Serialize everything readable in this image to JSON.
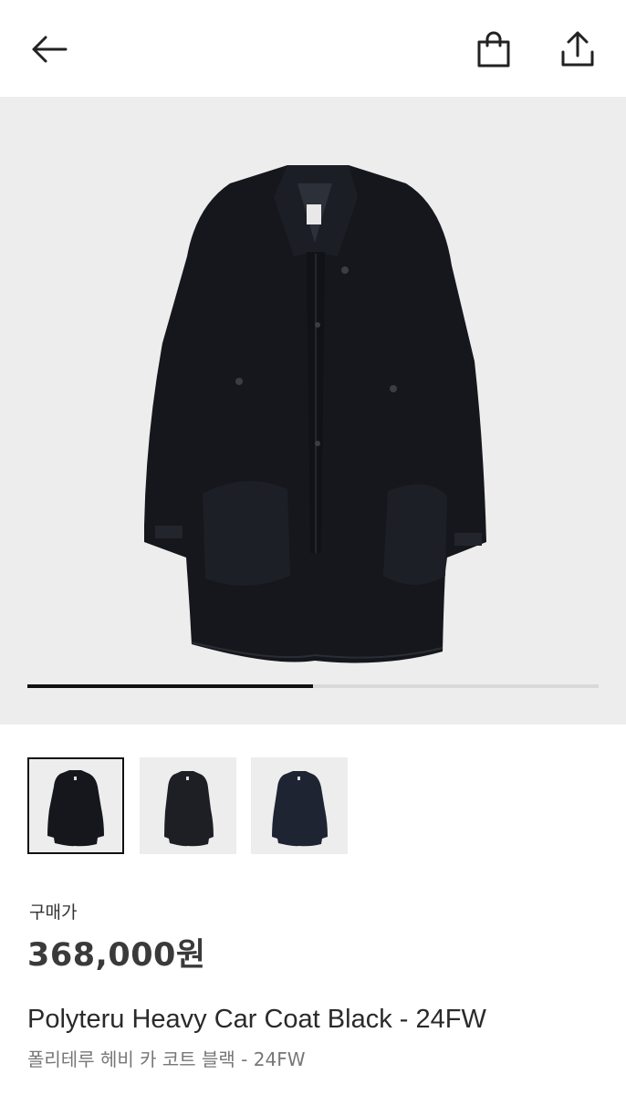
{
  "header": {
    "back_icon": "arrow-left-icon",
    "bag_icon": "shopping-bag-icon",
    "share_icon": "share-upload-icon"
  },
  "gallery": {
    "progress": 0.5,
    "thumbnails": [
      {
        "selected": true
      },
      {
        "selected": false
      },
      {
        "selected": false
      }
    ]
  },
  "price": {
    "label": "구매가",
    "value": "368,000원"
  },
  "product": {
    "name_en": "Polyteru Heavy Car Coat Black - 24FW",
    "name_ko": "폴리테루 헤비 카 코트 블랙 - 24FW"
  },
  "colors": {
    "background": "#ffffff",
    "image_bg": "#ededed",
    "coat": "#15171c",
    "accent": "#111111"
  }
}
